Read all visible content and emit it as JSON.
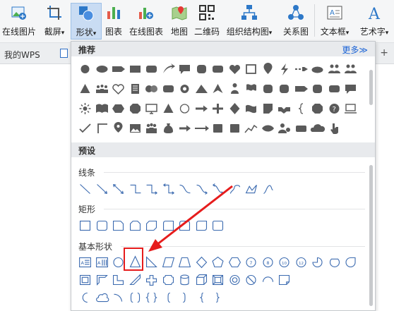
{
  "ribbon": {
    "buttons": [
      {
        "label": "在线图片",
        "icon": "online-picture-icon"
      },
      {
        "label": "截屏",
        "icon": "screenshot-icon",
        "has_dropdown": true
      },
      {
        "label": "形状",
        "icon": "shapes-icon",
        "has_dropdown": true,
        "active": true
      },
      {
        "label": "图表",
        "icon": "chart-icon"
      },
      {
        "label": "在线图表",
        "icon": "online-chart-icon"
      },
      {
        "label": "地图",
        "icon": "map-icon"
      },
      {
        "label": "二维码",
        "icon": "qr-code-icon"
      },
      {
        "label": "组织结构图",
        "icon": "org-chart-icon",
        "has_dropdown": true
      },
      {
        "label": "关系图",
        "icon": "relation-chart-icon"
      },
      {
        "label": "文本框",
        "icon": "textbox-icon",
        "has_dropdown": true
      },
      {
        "label": "艺术字",
        "icon": "wordart-icon",
        "has_dropdown": true
      }
    ],
    "dropdown_caret": "▾"
  },
  "tabs": {
    "doc_tab": "我的WPS",
    "new_tab": "+"
  },
  "shapes_panel": {
    "recommended_title": "推荐",
    "more_link": "更多≫",
    "presets_title": "预设",
    "lines_title": "线条",
    "rect_title": "矩形",
    "basic_title": "基本形状",
    "highlighted_shape": "isosceles-triangle",
    "colors": {
      "accent": "#3c6bb0",
      "highlight": "#e61c1c",
      "panel_header": "#e8eaed"
    },
    "basic_badges": [
      "7",
      "8",
      "10",
      "12"
    ]
  }
}
